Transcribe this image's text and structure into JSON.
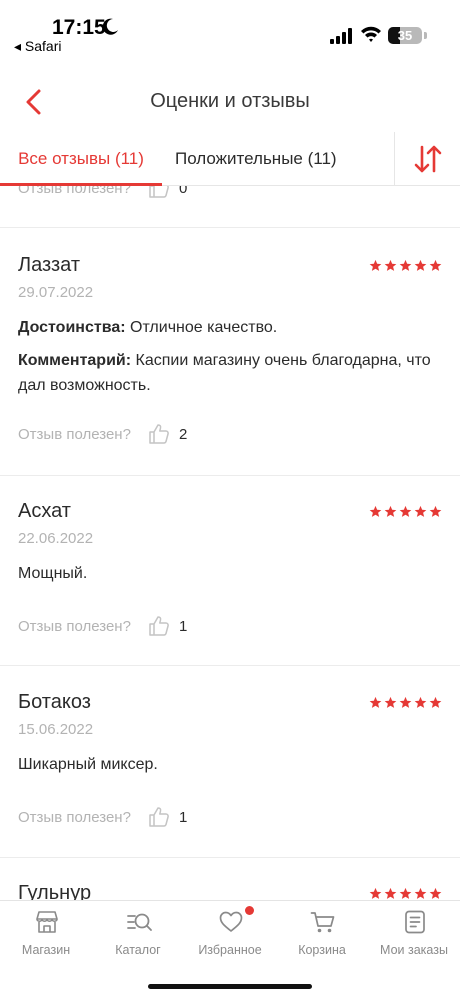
{
  "status_bar": {
    "time": "17:15",
    "back_app": "◂ Safari",
    "battery": "35",
    "battery_level": 0.35
  },
  "header": {
    "title": "Оценки и отзывы"
  },
  "tabs": {
    "all": "Все отзывы (11)",
    "positive": "Положительные (11)"
  },
  "partial_review": {
    "helpful_label": "Отзыв полезен?",
    "helpful_count": "0"
  },
  "reviews": [
    {
      "name": "Лаззат",
      "date": "29.07.2022",
      "stars": 5,
      "pros_label": "Достоинства:",
      "pros": " Отличное качество.",
      "comment_label": "Комментарий:",
      "comment": " Каспии магазину очень благодарна, что дал возможность.",
      "helpful_label": "Отзыв полезен?",
      "helpful_count": "2"
    },
    {
      "name": "Асхат",
      "date": "22.06.2022",
      "stars": 5,
      "text": "Мощный.",
      "helpful_label": "Отзыв полезен?",
      "helpful_count": "1"
    },
    {
      "name": "Ботакоз",
      "date": "15.06.2022",
      "stars": 5,
      "text": "Шикарный миксер.",
      "helpful_label": "Отзыв полезен?",
      "helpful_count": "1"
    },
    {
      "name": "Гульнур",
      "stars": 5
    }
  ],
  "bottom_nav": [
    {
      "label": "Магазин",
      "icon": "shop-icon"
    },
    {
      "label": "Каталог",
      "icon": "catalog-search-icon"
    },
    {
      "label": "Избранное",
      "icon": "heart-icon",
      "badge": true
    },
    {
      "label": "Корзина",
      "icon": "cart-icon"
    },
    {
      "label": "Мои заказы",
      "icon": "orders-icon"
    }
  ],
  "colors": {
    "accent": "#e53935",
    "text": "#2b2b2b",
    "muted": "#b3b3b3"
  }
}
